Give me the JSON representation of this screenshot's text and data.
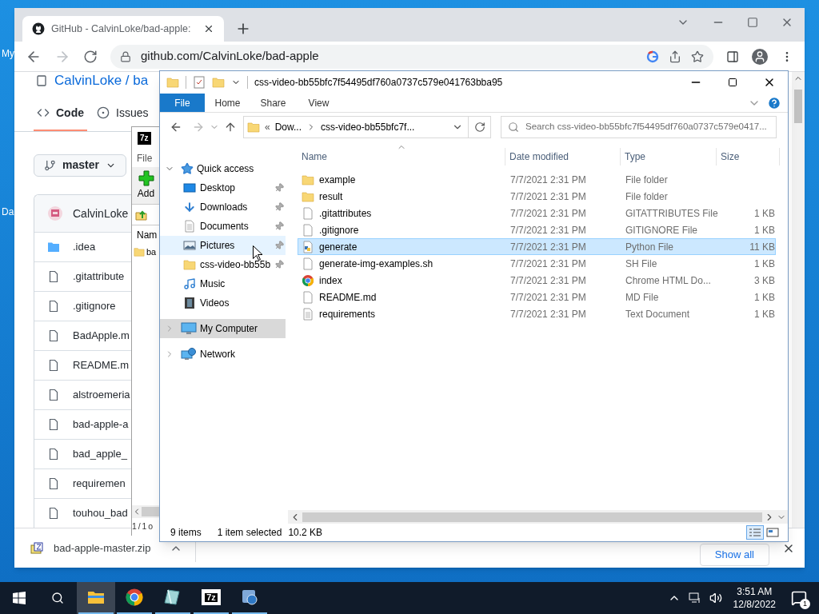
{
  "desktop": {
    "icon_labels": [
      "My",
      "Da"
    ]
  },
  "browser": {
    "tab_title": "GitHub - CalvinLoke/bad-apple:",
    "url": "github.com/CalvinLoke/bad-apple",
    "page": {
      "repo_heading": "CalvinLoke / ba",
      "tabs": [
        {
          "label": "Code",
          "selected": true
        },
        {
          "label": "Issues",
          "selected": false
        }
      ],
      "branch": "master",
      "author": "CalvinLoke",
      "files": [
        {
          "name": ".idea",
          "kind": "folder"
        },
        {
          "name": ".gitattribute",
          "kind": "file"
        },
        {
          "name": ".gitignore",
          "kind": "file"
        },
        {
          "name": "BadApple.m",
          "kind": "file"
        },
        {
          "name": "README.m",
          "kind": "file"
        },
        {
          "name": "alstroemeria",
          "kind": "file"
        },
        {
          "name": "bad-apple-a",
          "kind": "file"
        },
        {
          "name": "bad_apple_",
          "kind": "file"
        },
        {
          "name": "requiremen",
          "kind": "file"
        },
        {
          "name": "touhou_bad",
          "kind": "file"
        }
      ]
    },
    "download": {
      "file": "bad-apple-master.zip",
      "show_all": "Show all"
    }
  },
  "archiver": {
    "logo": "7z",
    "menu": "File",
    "add": "Add",
    "column": "Nam",
    "row": "ba",
    "status": "1 / 1 o"
  },
  "explorer": {
    "title": "css-video-bb55bfc7f54495df760a0737c579e041763bba95",
    "ribbon_tabs": [
      {
        "label": "File",
        "selected": true
      },
      {
        "label": "Home",
        "selected": false
      },
      {
        "label": "Share",
        "selected": false
      },
      {
        "label": "View",
        "selected": false
      }
    ],
    "breadcrumb_overflow": "«",
    "breadcrumb": [
      "Dow...",
      "css-video-bb55bfc7f..."
    ],
    "search_placeholder": "Search css-video-bb55bfc7f54495df760a0737c579e0417...",
    "nav": [
      {
        "label": "Quick access",
        "kind": "star",
        "expanded": true,
        "selected": false,
        "hovered": false,
        "children": [
          {
            "label": "Desktop",
            "kind": "desktop",
            "pinned": true,
            "selected": false,
            "hovered": false
          },
          {
            "label": "Downloads",
            "kind": "download",
            "pinned": true,
            "selected": false,
            "hovered": false
          },
          {
            "label": "Documents",
            "kind": "document",
            "pinned": true,
            "selected": false,
            "hovered": false
          },
          {
            "label": "Pictures",
            "kind": "picture",
            "pinned": true,
            "selected": false,
            "hovered": true
          },
          {
            "label": "css-video-bb55b",
            "kind": "folder",
            "pinned": true,
            "selected": false,
            "hovered": false
          },
          {
            "label": "Music",
            "kind": "music",
            "pinned": false,
            "selected": false,
            "hovered": false
          },
          {
            "label": "Videos",
            "kind": "video",
            "pinned": false,
            "selected": false,
            "hovered": false
          }
        ]
      },
      {
        "label": "My Computer",
        "kind": "computer",
        "expanded": false,
        "selected": true,
        "hovered": false
      },
      {
        "label": "Network",
        "kind": "network",
        "expanded": false,
        "selected": false,
        "hovered": false
      }
    ],
    "columns": [
      {
        "label": "Name",
        "sorted": true
      },
      {
        "label": "Date modified",
        "sorted": false
      },
      {
        "label": "Type",
        "sorted": false
      },
      {
        "label": "Size",
        "sorted": false
      }
    ],
    "rows": [
      {
        "name": "example",
        "date": "7/7/2021 2:31 PM",
        "type": "File folder",
        "kind": "folder",
        "selected": false
      },
      {
        "name": "result",
        "date": "7/7/2021 2:31 PM",
        "type": "File folder",
        "kind": "folder",
        "selected": false
      },
      {
        "name": ".gitattributes",
        "date": "7/7/2021 2:31 PM",
        "type": "GITATTRIBUTES File",
        "size": "1 KB",
        "kind": "file",
        "selected": false
      },
      {
        "name": ".gitignore",
        "date": "7/7/2021 2:31 PM",
        "type": "GITIGNORE File",
        "size": "1 KB",
        "kind": "file",
        "selected": false
      },
      {
        "name": "generate",
        "date": "7/7/2021 2:31 PM",
        "type": "Python File",
        "size": "11 KB",
        "kind": "python",
        "selected": true
      },
      {
        "name": "generate-img-examples.sh",
        "date": "7/7/2021 2:31 PM",
        "type": "SH File",
        "size": "1 KB",
        "kind": "file",
        "selected": false
      },
      {
        "name": "index",
        "date": "7/7/2021 2:31 PM",
        "type": "Chrome HTML Do...",
        "size": "3 KB",
        "kind": "browser",
        "selected": false
      },
      {
        "name": "README.md",
        "date": "7/7/2021 2:31 PM",
        "type": "MD File",
        "size": "1 KB",
        "kind": "file",
        "selected": false
      },
      {
        "name": "requirements",
        "date": "7/7/2021 2:31 PM",
        "type": "Text Document",
        "size": "1 KB",
        "kind": "text",
        "selected": false
      }
    ],
    "status": {
      "count": "9 items",
      "selection": "1 item selected",
      "size": "10.2 KB"
    },
    "views": [
      {
        "kind": "details",
        "selected": true
      },
      {
        "kind": "tiles",
        "selected": false
      }
    ]
  },
  "taskbar": {
    "apps": [
      {
        "kind": "explorer",
        "active": true,
        "running": true
      },
      {
        "kind": "browser",
        "active": false,
        "running": true
      },
      {
        "kind": "crystal",
        "active": false,
        "running": true
      },
      {
        "kind": "archiver",
        "label": "7z",
        "active": false,
        "running": true
      },
      {
        "kind": "tool",
        "active": false,
        "running": true
      }
    ],
    "time": "3:51 AM",
    "date": "12/8/2022",
    "notifications": "1"
  }
}
